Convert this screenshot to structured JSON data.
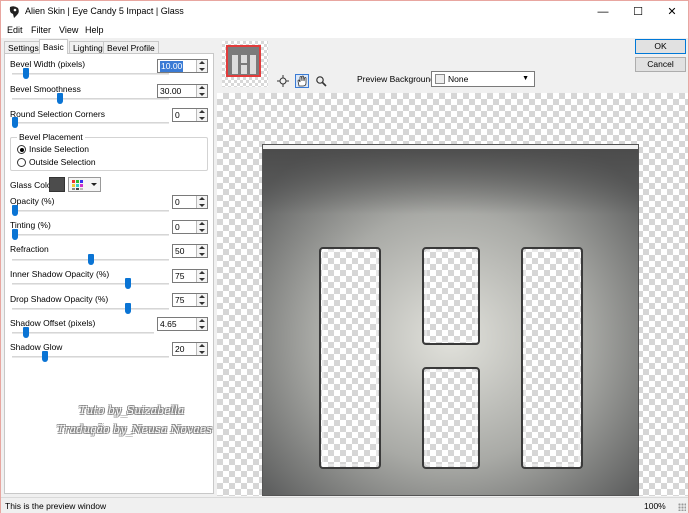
{
  "window": {
    "title": "Alien Skin | Eye Candy 5 Impact | Glass",
    "minimize": "—",
    "maximize": "☐",
    "close": "✕"
  },
  "menu": [
    "Edit",
    "Filter",
    "View",
    "Help"
  ],
  "tabs": [
    {
      "label": "Settings",
      "active": false
    },
    {
      "label": "Basic",
      "active": true
    },
    {
      "label": "Lighting",
      "active": false
    },
    {
      "label": "Bevel Profile",
      "active": false
    }
  ],
  "controls": [
    {
      "label": "Bevel Width (pixels)",
      "value": "10.00",
      "selected": true,
      "level": 0.07
    },
    {
      "label": "Bevel Smoothness",
      "value": "30.00",
      "selected": false,
      "level": 0.3
    },
    {
      "label": "Round Selection Corners",
      "value": "0",
      "selected": false,
      "level": 0.0
    }
  ],
  "bevel_placement": {
    "title": "Bevel Placement",
    "options": [
      {
        "label": "Inside Selection",
        "checked": true
      },
      {
        "label": "Outside Selection",
        "checked": false
      }
    ]
  },
  "glass_color": {
    "label": "Glass Color",
    "swatch": "#4c4c4c"
  },
  "controls2": [
    {
      "label": "Opacity (%)",
      "value": "0",
      "level": 0.0
    },
    {
      "label": "Tinting (%)",
      "value": "0",
      "level": 0.0
    },
    {
      "label": "Refraction",
      "value": "50",
      "level": 0.5
    },
    {
      "label": "Inner Shadow Opacity (%)",
      "value": "75",
      "level": 0.75
    },
    {
      "label": "Drop Shadow Opacity (%)",
      "value": "75",
      "level": 0.75
    },
    {
      "label": "Shadow Offset (pixels)",
      "value": "4.65",
      "level": 0.08
    },
    {
      "label": "Shadow Glow",
      "value": "20",
      "level": 0.2
    }
  ],
  "buttons": {
    "ok": "OK",
    "cancel": "Cancel"
  },
  "preview_background": {
    "label": "Preview Background:",
    "value": "None"
  },
  "watermark": {
    "line1": "Tuto by_Suizabella",
    "line2": "Tradução by_Neusa Novaes"
  },
  "status": {
    "text": "This is the preview window",
    "zoom": "100%"
  },
  "colors": {
    "accent": "#0a74d4",
    "selection": "#3a7bd5"
  }
}
